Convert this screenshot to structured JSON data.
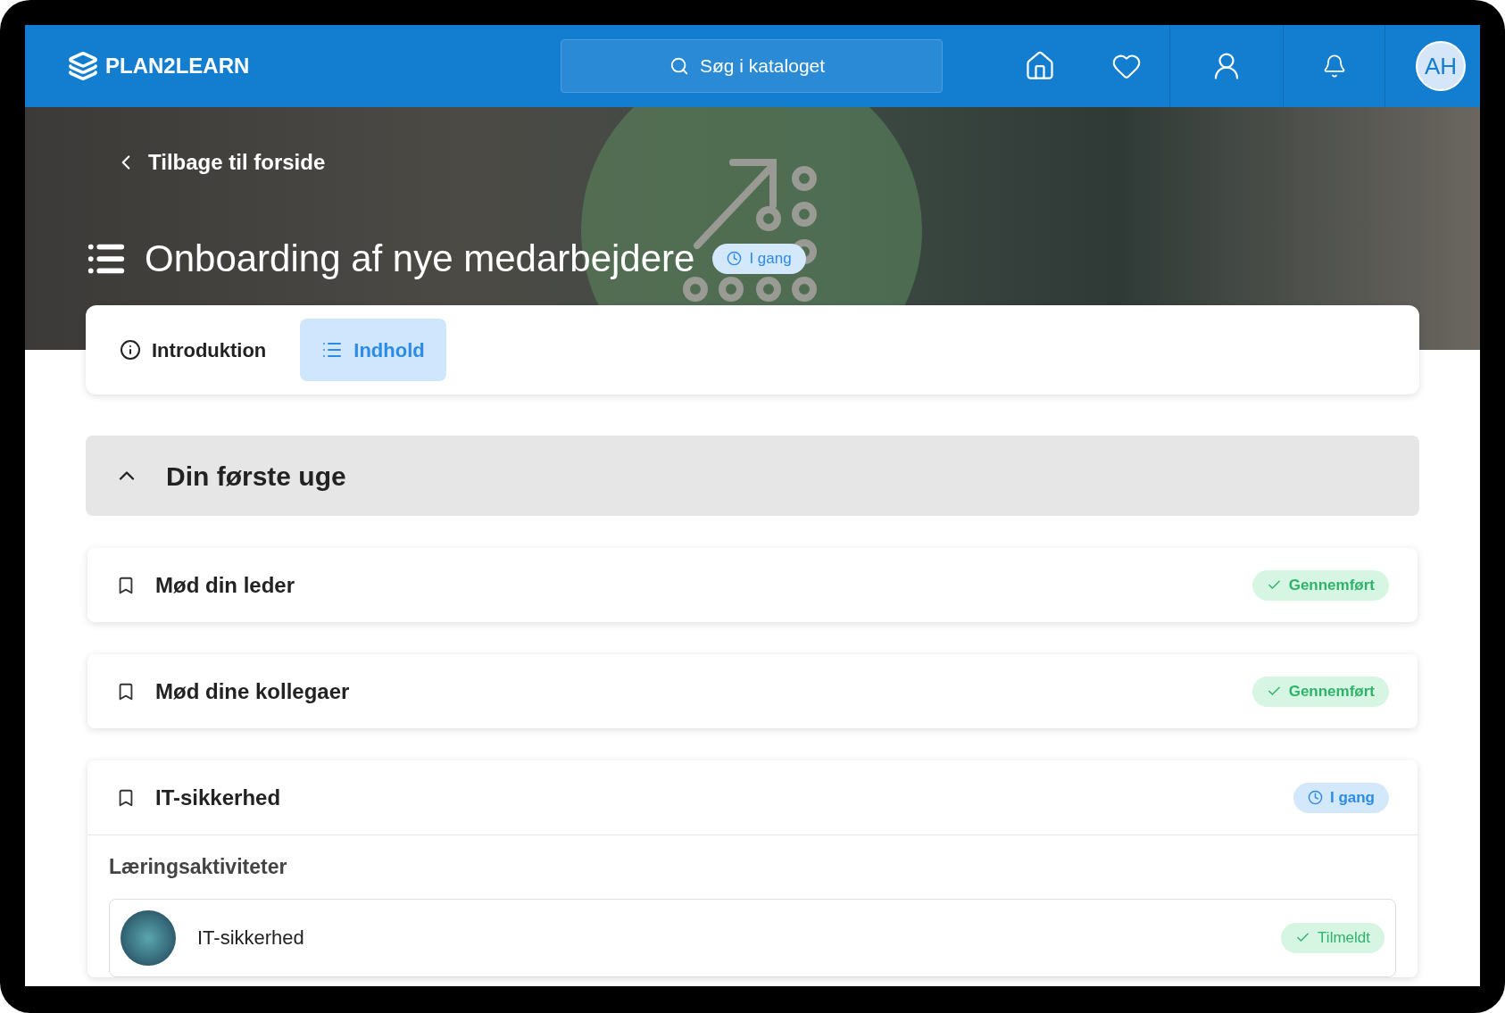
{
  "header": {
    "logo": "PLAN2LEARN",
    "search": {
      "placeholder": "Søg i kataloget"
    },
    "avatar": "AH"
  },
  "hero": {
    "back_link": "Tilbage til forside",
    "title": "Onboarding af nye medarbejdere",
    "status": {
      "kind": "in_progress",
      "label": "I gang"
    }
  },
  "tabs": [
    {
      "label": "Introduktion",
      "kind": "info",
      "selected": false
    },
    {
      "label": "Indhold",
      "kind": "list",
      "selected": true
    }
  ],
  "section": {
    "title": "Din første uge",
    "expanded": true,
    "items": [
      {
        "title": "Mød din leder",
        "status": {
          "kind": "done",
          "label": "Gennemført"
        }
      },
      {
        "title": "Mød dine kollegaer",
        "status": {
          "kind": "done",
          "label": "Gennemført"
        }
      },
      {
        "title": "IT-sikkerhed",
        "status": {
          "kind": "in_progress",
          "label": "I gang"
        },
        "activities_heading": "Læringsaktiviteter",
        "activities": [
          {
            "title": "IT-sikkerhed",
            "status": {
              "kind": "enrolled",
              "label": "Tilmeldt"
            }
          }
        ]
      }
    ]
  }
}
